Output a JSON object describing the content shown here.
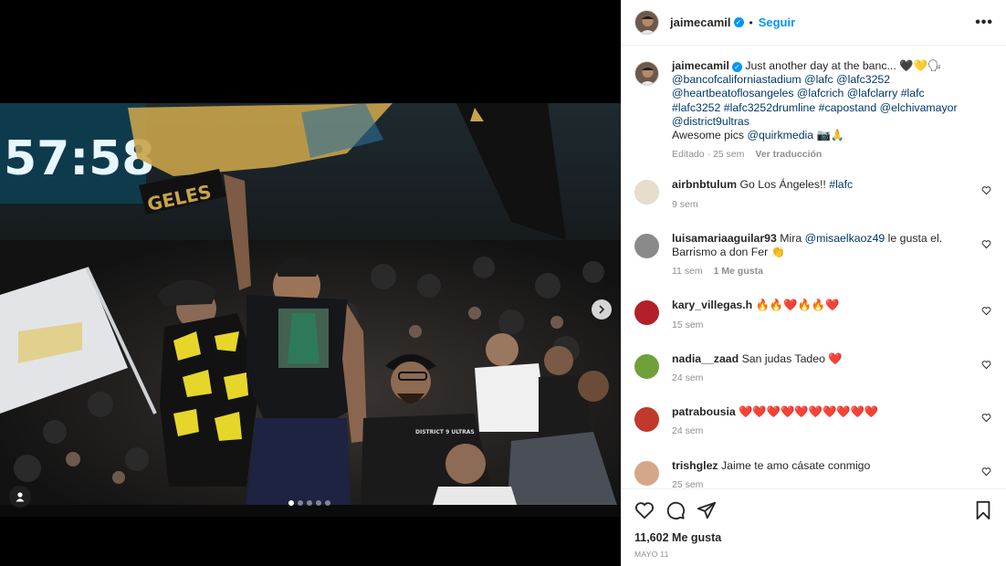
{
  "post": {
    "author": "jaimecamil",
    "follow_label": "Seguir",
    "separator": "•",
    "more_label": "•••",
    "caption_text": "Just another day at the banc... 🖤💛🗣 ",
    "caption_mentions": "@bancofcaliforniastadium @lafc @lafc3252 @heartbeatoflosangeles @lafcrich @lafclarry #lafc #lafc3252 #lafc3252drumline #capostand @elchivamayor @district9ultras",
    "caption_end": "Awesome pics ",
    "caption_end_link": "@quirkmedia",
    "caption_end_emoji": " 📷🙏",
    "edited_label": "Editado · 25 sem",
    "translate_label": "Ver traducción",
    "likes_count": "11,602",
    "likes_label": "Me gusta",
    "date": "MAYO 11"
  },
  "media": {
    "scoreboard_time": "57:58",
    "scarf_text": "GELES",
    "shirt_text": "DISTRICT 9 ULTRAS",
    "carousel_dots": 5,
    "carousel_active": 1
  },
  "comments": [
    {
      "user": "airbnbtulum",
      "text": "Go Los Ángeles!! ",
      "link": "#lafc",
      "time": "9 sem",
      "likes": "",
      "avatar_color": "#e8dccb"
    },
    {
      "user": "luisamariaaguilar93",
      "text": "Mira ",
      "link": "@misaelkaoz49",
      "text_after": " le gusta el. Barrismo a don Fer 👏",
      "time": "11 sem",
      "likes": "1 Me gusta",
      "avatar_color": "#8a8a8a"
    },
    {
      "user": "kary_villegas.h",
      "text": "🔥🔥❤️🔥🔥❤️",
      "time": "15 sem",
      "likes": "",
      "avatar_color": "#b3202a"
    },
    {
      "user": "nadia__zaad",
      "text": "San judas Tadeo ❤️",
      "time": "24 sem",
      "likes": "",
      "avatar_color": "#6fa03a"
    },
    {
      "user": "patrabousia",
      "text": "❤️❤️❤️❤️❤️❤️❤️❤️❤️❤️",
      "time": "24 sem",
      "likes": "",
      "avatar_color": "#c0392b"
    },
    {
      "user": "trishglez",
      "text": "Jaime te amo cásate conmigo",
      "time": "25 sem",
      "likes": "",
      "avatar_color": "#d4a78a"
    }
  ],
  "icons": {
    "verified": "verified-badge-icon",
    "heart": "heart-icon",
    "comment": "comment-icon",
    "share": "share-icon",
    "save": "bookmark-icon",
    "next": "chevron-right-icon",
    "tag": "user-tag-icon"
  },
  "colors": {
    "accent": "#0095f6",
    "text": "#262626",
    "muted": "#8e8e8e",
    "link": "#00376b",
    "lafc_gold": "#c9a44a"
  }
}
